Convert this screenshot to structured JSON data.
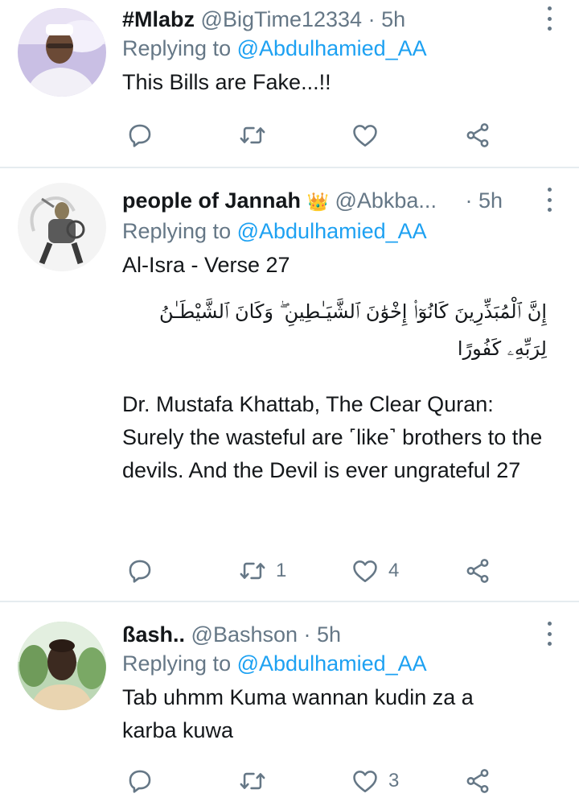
{
  "tweets": [
    {
      "display_name": "#Mlabz",
      "handle": "@BigTime12334",
      "time": "· 5h",
      "replying_prefix": "Replying to",
      "replying_to": "@Abdulhamied_AA",
      "text": "This Bills are Fake...!!",
      "actions": {
        "reply": "",
        "retweet": "",
        "like": ""
      }
    },
    {
      "display_name": "people of Jannah",
      "badge": "👑",
      "handle": "@Abkba...",
      "time": "· 5h",
      "replying_prefix": "Replying to",
      "replying_to": "@Abdulhamied_AA",
      "text_line1": "Al-Isra - Verse 27",
      "arabic": "إِنَّ ٱلْمُبَذِّرِينَ كَانُوٓا۟ إِخْوَٰنَ ٱلشَّيَـٰطِينِ ۖ وَكَانَ ٱلشَّيْطَـٰنُ لِرَبِّهِۦ كَفُورًا",
      "translation": "Dr. Mustafa Khattab, The Clear Quran: Surely the wasteful are ˹like˺ brothers to the devils. And the Devil is ever ungrateful 27",
      "actions": {
        "reply": "",
        "retweet": "1",
        "like": "4"
      }
    },
    {
      "display_name": "ßash..",
      "handle": "@Bashson",
      "time": "· 5h",
      "replying_prefix": "Replying to",
      "replying_to": "@Abdulhamied_AA",
      "text": "Tab uhmm Kuma wannan kudin za a karba kuwa",
      "actions": {
        "reply": "",
        "retweet": "",
        "like": "3"
      }
    }
  ],
  "icons": {
    "reply": "reply-icon",
    "retweet": "retweet-icon",
    "like": "heart-icon",
    "share": "share-icon",
    "more": "more-vertical-icon"
  },
  "colors": {
    "link": "#1da1f2",
    "muted": "#657786",
    "text": "#14171a",
    "divider": "#e6ecf0"
  }
}
